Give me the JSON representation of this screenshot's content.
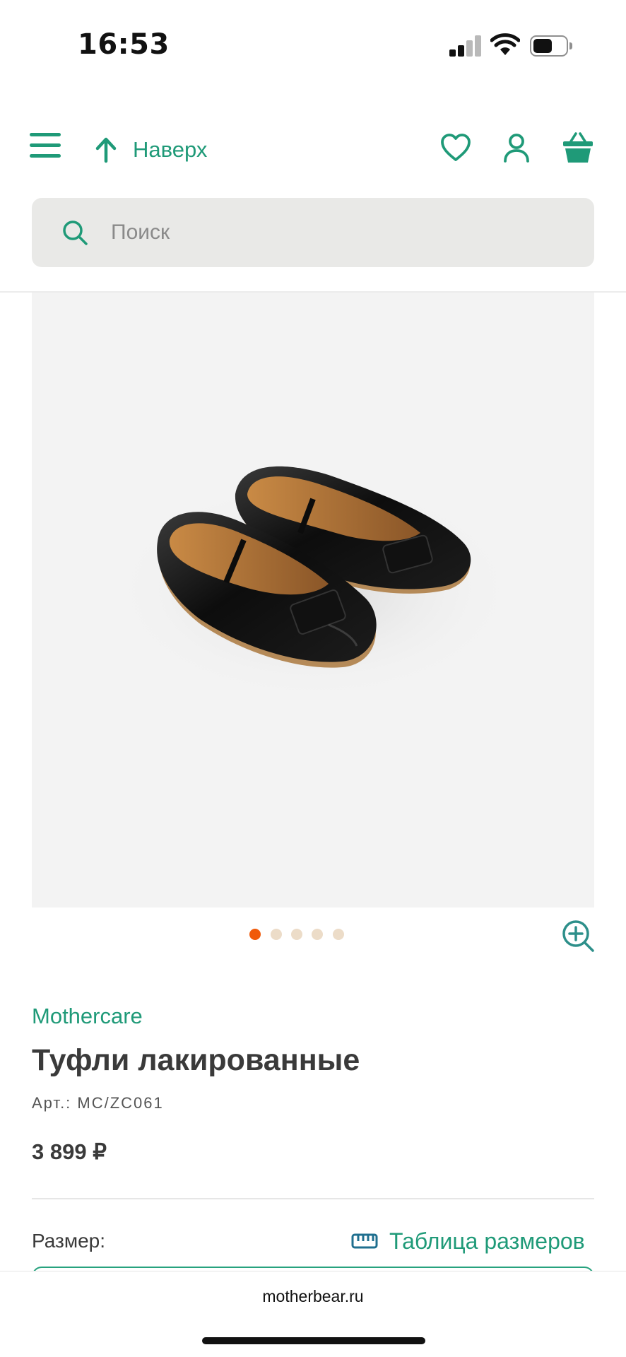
{
  "status_bar": {
    "time": "16:53"
  },
  "header": {
    "up_label": "Наверх",
    "icons": [
      "menu-icon",
      "arrow-up-icon",
      "heart-icon",
      "user-icon",
      "basket-icon"
    ]
  },
  "search": {
    "placeholder": "Поиск"
  },
  "gallery": {
    "image": "black-patent-ballet-flats",
    "dots_total": 5,
    "active_dot": 0
  },
  "product": {
    "brand": "Mothercare",
    "title": "Туфли лакированные",
    "article": "Арт.: MC/ZC061",
    "price": "3 899 ₽",
    "size_label": "Размер:",
    "size_table_label": "Таблица размеров"
  },
  "browser": {
    "url": "motherbear.ru"
  },
  "colors": {
    "accent": "#1f9a78",
    "active_dot": "#f05a0a",
    "inactive_dot": "#ecdcc8",
    "text": "#3a3a3a"
  }
}
